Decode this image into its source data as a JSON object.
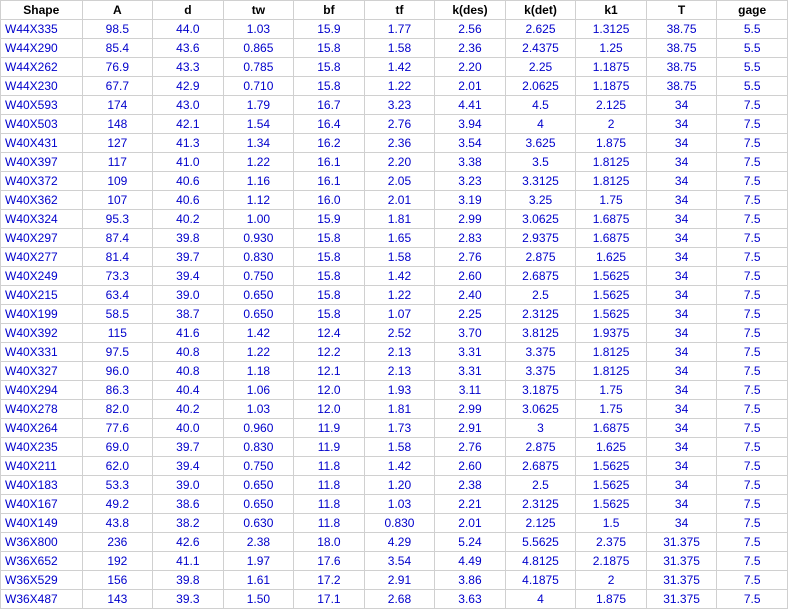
{
  "headers": [
    "Shape",
    "A",
    "d",
    "tw",
    "bf",
    "tf",
    "k(des)",
    "k(det)",
    "k1",
    "T",
    "gage"
  ],
  "rows": [
    [
      "W44X335",
      "98.5",
      "44.0",
      "1.03",
      "15.9",
      "1.77",
      "2.56",
      "2.625",
      "1.3125",
      "38.75",
      "5.5"
    ],
    [
      "W44X290",
      "85.4",
      "43.6",
      "0.865",
      "15.8",
      "1.58",
      "2.36",
      "2.4375",
      "1.25",
      "38.75",
      "5.5"
    ],
    [
      "W44X262",
      "76.9",
      "43.3",
      "0.785",
      "15.8",
      "1.42",
      "2.20",
      "2.25",
      "1.1875",
      "38.75",
      "5.5"
    ],
    [
      "W44X230",
      "67.7",
      "42.9",
      "0.710",
      "15.8",
      "1.22",
      "2.01",
      "2.0625",
      "1.1875",
      "38.75",
      "5.5"
    ],
    [
      "W40X593",
      "174",
      "43.0",
      "1.79",
      "16.7",
      "3.23",
      "4.41",
      "4.5",
      "2.125",
      "34",
      "7.5"
    ],
    [
      "W40X503",
      "148",
      "42.1",
      "1.54",
      "16.4",
      "2.76",
      "3.94",
      "4",
      "2",
      "34",
      "7.5"
    ],
    [
      "W40X431",
      "127",
      "41.3",
      "1.34",
      "16.2",
      "2.36",
      "3.54",
      "3.625",
      "1.875",
      "34",
      "7.5"
    ],
    [
      "W40X397",
      "117",
      "41.0",
      "1.22",
      "16.1",
      "2.20",
      "3.38",
      "3.5",
      "1.8125",
      "34",
      "7.5"
    ],
    [
      "W40X372",
      "109",
      "40.6",
      "1.16",
      "16.1",
      "2.05",
      "3.23",
      "3.3125",
      "1.8125",
      "34",
      "7.5"
    ],
    [
      "W40X362",
      "107",
      "40.6",
      "1.12",
      "16.0",
      "2.01",
      "3.19",
      "3.25",
      "1.75",
      "34",
      "7.5"
    ],
    [
      "W40X324",
      "95.3",
      "40.2",
      "1.00",
      "15.9",
      "1.81",
      "2.99",
      "3.0625",
      "1.6875",
      "34",
      "7.5"
    ],
    [
      "W40X297",
      "87.4",
      "39.8",
      "0.930",
      "15.8",
      "1.65",
      "2.83",
      "2.9375",
      "1.6875",
      "34",
      "7.5"
    ],
    [
      "W40X277",
      "81.4",
      "39.7",
      "0.830",
      "15.8",
      "1.58",
      "2.76",
      "2.875",
      "1.625",
      "34",
      "7.5"
    ],
    [
      "W40X249",
      "73.3",
      "39.4",
      "0.750",
      "15.8",
      "1.42",
      "2.60",
      "2.6875",
      "1.5625",
      "34",
      "7.5"
    ],
    [
      "W40X215",
      "63.4",
      "39.0",
      "0.650",
      "15.8",
      "1.22",
      "2.40",
      "2.5",
      "1.5625",
      "34",
      "7.5"
    ],
    [
      "W40X199",
      "58.5",
      "38.7",
      "0.650",
      "15.8",
      "1.07",
      "2.25",
      "2.3125",
      "1.5625",
      "34",
      "7.5"
    ],
    [
      "W40X392",
      "115",
      "41.6",
      "1.42",
      "12.4",
      "2.52",
      "3.70",
      "3.8125",
      "1.9375",
      "34",
      "7.5"
    ],
    [
      "W40X331",
      "97.5",
      "40.8",
      "1.22",
      "12.2",
      "2.13",
      "3.31",
      "3.375",
      "1.8125",
      "34",
      "7.5"
    ],
    [
      "W40X327",
      "96.0",
      "40.8",
      "1.18",
      "12.1",
      "2.13",
      "3.31",
      "3.375",
      "1.8125",
      "34",
      "7.5"
    ],
    [
      "W40X294",
      "86.3",
      "40.4",
      "1.06",
      "12.0",
      "1.93",
      "3.11",
      "3.1875",
      "1.75",
      "34",
      "7.5"
    ],
    [
      "W40X278",
      "82.0",
      "40.2",
      "1.03",
      "12.0",
      "1.81",
      "2.99",
      "3.0625",
      "1.75",
      "34",
      "7.5"
    ],
    [
      "W40X264",
      "77.6",
      "40.0",
      "0.960",
      "11.9",
      "1.73",
      "2.91",
      "3",
      "1.6875",
      "34",
      "7.5"
    ],
    [
      "W40X235",
      "69.0",
      "39.7",
      "0.830",
      "11.9",
      "1.58",
      "2.76",
      "2.875",
      "1.625",
      "34",
      "7.5"
    ],
    [
      "W40X211",
      "62.0",
      "39.4",
      "0.750",
      "11.8",
      "1.42",
      "2.60",
      "2.6875",
      "1.5625",
      "34",
      "7.5"
    ],
    [
      "W40X183",
      "53.3",
      "39.0",
      "0.650",
      "11.8",
      "1.20",
      "2.38",
      "2.5",
      "1.5625",
      "34",
      "7.5"
    ],
    [
      "W40X167",
      "49.2",
      "38.6",
      "0.650",
      "11.8",
      "1.03",
      "2.21",
      "2.3125",
      "1.5625",
      "34",
      "7.5"
    ],
    [
      "W40X149",
      "43.8",
      "38.2",
      "0.630",
      "11.8",
      "0.830",
      "2.01",
      "2.125",
      "1.5",
      "34",
      "7.5"
    ],
    [
      "W36X800",
      "236",
      "42.6",
      "2.38",
      "18.0",
      "4.29",
      "5.24",
      "5.5625",
      "2.375",
      "31.375",
      "7.5"
    ],
    [
      "W36X652",
      "192",
      "41.1",
      "1.97",
      "17.6",
      "3.54",
      "4.49",
      "4.8125",
      "2.1875",
      "31.375",
      "7.5"
    ],
    [
      "W36X529",
      "156",
      "39.8",
      "1.61",
      "17.2",
      "2.91",
      "3.86",
      "4.1875",
      "2",
      "31.375",
      "7.5"
    ],
    [
      "W36X487",
      "143",
      "39.3",
      "1.50",
      "17.1",
      "2.68",
      "3.63",
      "4",
      "1.875",
      "31.375",
      "7.5"
    ]
  ]
}
